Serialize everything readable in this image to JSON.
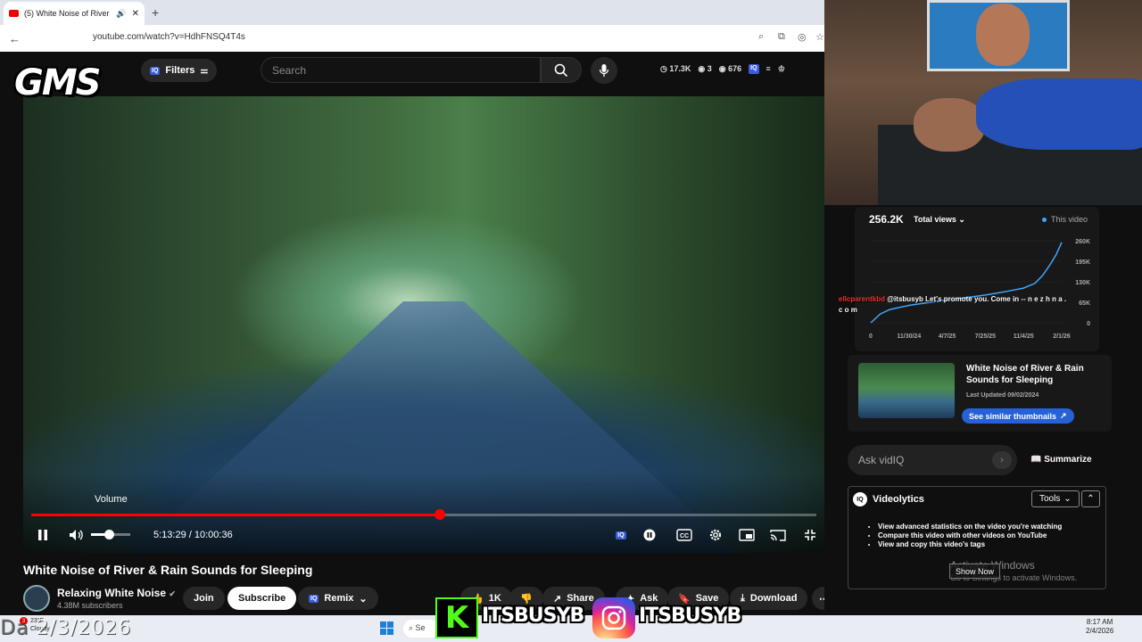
{
  "browser": {
    "tab_title": "(5) White Noise of River &",
    "url": "youtube.com/watch?v=HdhFNSQ4T4s"
  },
  "overlay": {
    "logo_text": "GMS",
    "day_prefix": "Da",
    "date_text": "2/3/2026",
    "kick_handle": "ITSBUSYB",
    "insta_handle": "ITSBUSYB"
  },
  "header": {
    "filters_label": "Filters",
    "search_placeholder": "Search",
    "stat_views": "17.3K",
    "stat_watch": "3",
    "stat_likes": "676"
  },
  "player": {
    "volume_tooltip": "Volume",
    "current_time": "5:13:29",
    "duration": "10:00:36",
    "time_display": "5:13:29 / 10:00:36",
    "progress_fraction": 0.52,
    "volume_fraction": 0.45
  },
  "video": {
    "title": "White Noise of River & Rain Sounds for Sleeping",
    "channel_name": "Relaxing White Noise",
    "subscribers": "4.38M subscribers",
    "join_label": "Join",
    "subscribe_label": "Subscribe",
    "remix_label": "Remix",
    "likes": "1K",
    "share_label": "Share",
    "ask_label": "Ask",
    "save_label": "Save",
    "download_label": "Download"
  },
  "sidebar": {
    "views_total": "256.2K",
    "views_dropdown": "Total views",
    "legend_this_video": "This video",
    "chat_user": "ellcparentkbd",
    "chat_text": "@itsbusyb Let's promote you. Come in -- n e z h n a . c o m",
    "thumb_title": "White Noise of River & Rain Sounds for Sleeping",
    "thumb_updated": "Last Updated 09/02/2024",
    "similar_btn": "See similar thumbnails",
    "ask_placeholder": "Ask vidIQ",
    "summarize_label": "Summarize",
    "videolytics_title": "Videolytics",
    "tools_label": "Tools",
    "bullets": [
      "View advanced statistics on the video you're watching",
      "Compare this video with other videos on YouTube",
      "View and copy this video's tags"
    ],
    "activate_title": "Activate Windows",
    "activate_sub": "Go to Settings to activate Windows.",
    "show_now": "Show Now"
  },
  "chart_data": {
    "type": "line",
    "title": "",
    "x_ticks": [
      "0",
      "11/30/24",
      "4/7/25",
      "7/25/25",
      "11/4/25",
      "2/1/26"
    ],
    "y_ticks": [
      "0",
      "65K",
      "130K",
      "195K",
      "260K"
    ],
    "ylim": [
      0,
      260000
    ],
    "series": [
      {
        "name": "This video",
        "color": "#3ea6ff",
        "x": [
          0,
          0.05,
          0.1,
          0.2,
          0.3,
          0.4,
          0.5,
          0.6,
          0.7,
          0.8,
          0.86,
          0.9,
          0.94,
          0.97,
          1.0
        ],
        "y": [
          0,
          28000,
          42000,
          55000,
          64000,
          72000,
          80000,
          88000,
          98000,
          110000,
          125000,
          150000,
          185000,
          215000,
          255000
        ]
      }
    ]
  },
  "taskbar": {
    "temperature": "23°F",
    "weather": "Cloudy",
    "search_label": "Se",
    "time": "8:17 AM",
    "date": "2/4/2026",
    "notif_count": "3"
  },
  "colors": {
    "accent_red": "#ff0000",
    "vidiq_blue": "#2761d6",
    "chart_line": "#3ea6ff",
    "kick_green": "#53fc18"
  }
}
